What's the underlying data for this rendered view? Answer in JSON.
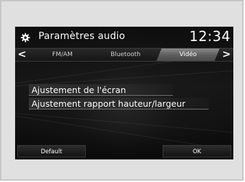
{
  "header": {
    "title": "Paramètres audio",
    "time": "12:34",
    "icon": "gear-icon"
  },
  "tabs": {
    "left_arrow": "<",
    "right_arrow": ">",
    "items": [
      {
        "label": "FM/AM"
      },
      {
        "label": "Bluetooth"
      },
      {
        "label": "Vidéo",
        "selected": true
      }
    ]
  },
  "menu": {
    "items": [
      {
        "label": "Ajustement de l'écran"
      },
      {
        "label": "Ajustement rapport hauteur/largeur"
      }
    ]
  },
  "footer": {
    "default_label": "Default",
    "ok_label": "OK"
  },
  "colors": {
    "screen_bg": "#0a0a0a",
    "selected_tab": "#7a7a7a",
    "text": "#ffffff",
    "frame": "#e0e0e0"
  }
}
